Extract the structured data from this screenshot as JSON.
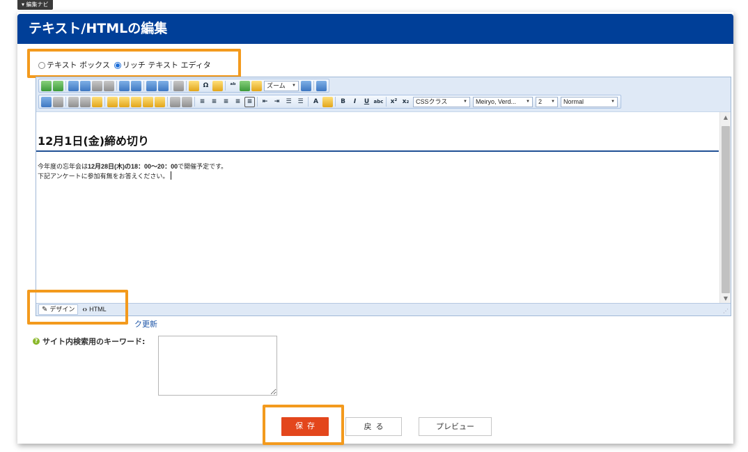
{
  "nav_tab": "▾ 編集ナビ",
  "header": {
    "title": "テキスト/HTMLの編集"
  },
  "editor_mode": {
    "options": [
      {
        "label": "テキスト ボックス",
        "selected": false
      },
      {
        "label": "リッチ テキスト エディタ",
        "selected": true
      }
    ]
  },
  "toolbar": {
    "zoom_label": "ズーム",
    "css_class": "CSSクラス",
    "font_name": "Meiryo, Verd...",
    "font_size": "2",
    "format": "Normal",
    "bold_glyph": "B",
    "italic_glyph": "I",
    "underline_glyph": "U",
    "strike_glyph": "abc",
    "sup_glyph": "x²",
    "sub_glyph": "x₂",
    "font_color_glyph": "A"
  },
  "content": {
    "heading": "12月1日(金)締め切り",
    "line1_prefix": "今年度の忘年会は",
    "line1_bold1": "12月28日(木)の18：00〜20：00",
    "line1_suffix": "で開催予定です。",
    "line2": "下記アンケートに参加有無をお答えください。"
  },
  "mode_tabs": {
    "design": "デザイン",
    "html": "HTML"
  },
  "update_link": "ク更新",
  "keyword": {
    "label": "サイト内検索用のキーワード:",
    "value": ""
  },
  "buttons": {
    "save": "保存",
    "back": "戻る",
    "preview": "プレビュー"
  },
  "colors": {
    "header_bg": "#003f98",
    "highlight": "#f39a1d",
    "save_bg": "#e3461c"
  }
}
